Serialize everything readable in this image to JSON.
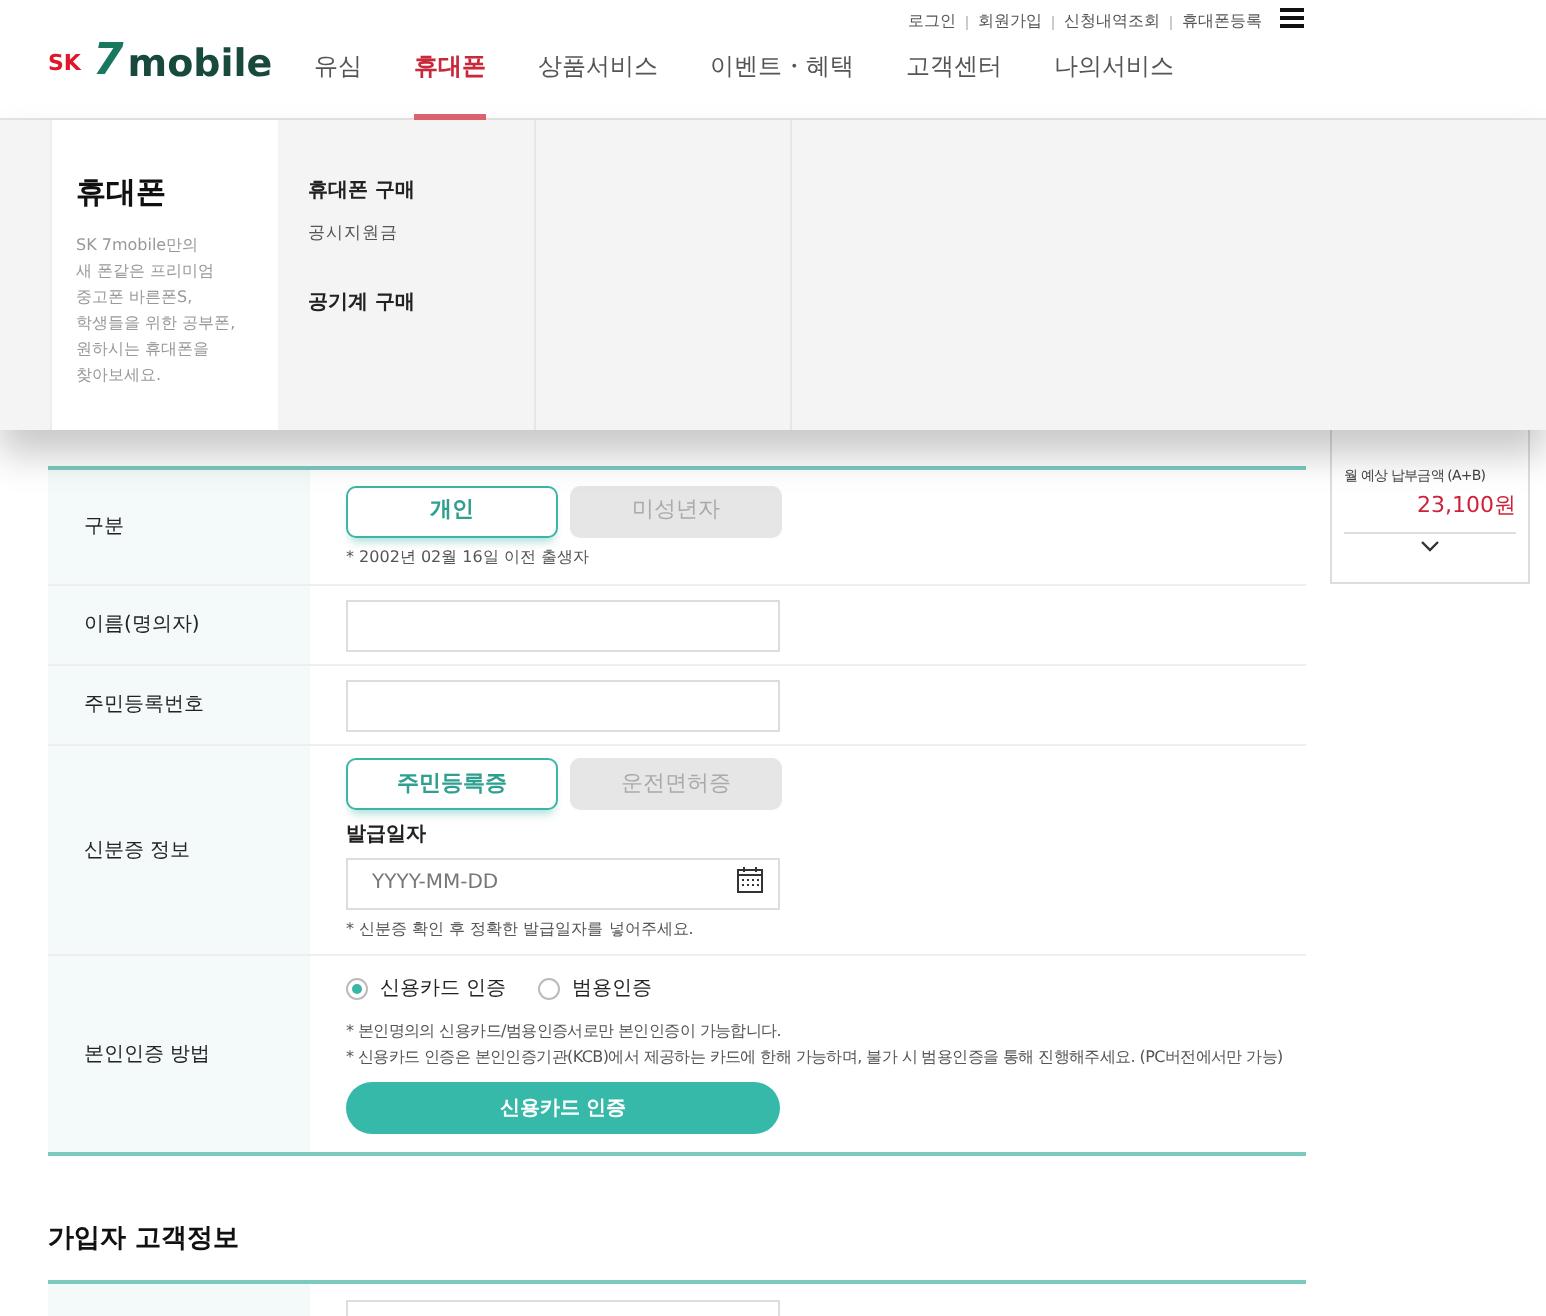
{
  "util_links": [
    "로그인",
    "회원가입",
    "신청내역조회",
    "휴대폰등록"
  ],
  "logo": {
    "prefix": "SK",
    "digit": "7",
    "word": "mobile"
  },
  "nav": [
    {
      "label": "유심",
      "selected": false
    },
    {
      "label": "휴대폰",
      "selected": true
    },
    {
      "label": "상품서비스",
      "selected": false
    },
    {
      "label": "이벤트・혜택",
      "selected": false
    },
    {
      "label": "고객센터",
      "selected": false
    },
    {
      "label": "나의서비스",
      "selected": false
    }
  ],
  "mega_menu": {
    "title": "휴대폰",
    "description": "SK 7mobile만의\n새 폰같은 프리미엄\n중고폰 바른폰S,\n학생들을 위한 공부폰,\n원하시는 휴대폰을\n찾아보세요.",
    "items": [
      {
        "label": "휴대폰 구매",
        "kind": "heading"
      },
      {
        "label": "공시지원금",
        "kind": "sub"
      },
      {
        "label": "공기계 구매",
        "kind": "heading"
      }
    ]
  },
  "form_rows": [
    {
      "label": "구분",
      "kind": "toggle",
      "options": [
        {
          "label": "개인",
          "selected": true
        },
        {
          "label": "미성년자",
          "selected": false
        }
      ],
      "note": "* 2002년 02월 16일 이전 출생자"
    },
    {
      "label": "이름(명의자)",
      "kind": "input"
    },
    {
      "label": "주민등록번호",
      "kind": "input"
    },
    {
      "label": "신분증 정보",
      "kind": "id",
      "options": [
        {
          "label": "주민등록증",
          "selected": true
        },
        {
          "label": "운전면허증",
          "selected": false
        }
      ],
      "date_label": "발급일자",
      "date_placeholder": "YYYY-MM-DD",
      "note": "* 신분증 확인 후 정확한 발급일자를 넣어주세요."
    },
    {
      "label": "본인인증 방법",
      "kind": "auth",
      "radios": [
        {
          "label": "신용카드 인증",
          "selected": true
        },
        {
          "label": "범용인증",
          "selected": false
        }
      ],
      "notes": [
        "* 본인명의의 신용카드/범용인증서로만 본인인증이 가능합니다.",
        "* 신용카드 인증은 본인인증기관(KCB)에서 제공하는 카드에 한해 가능하며, 불가 시 범용인증을 통해 진행해주세요. (PC버전에서만 가능)"
      ],
      "button": "신용카드 인증"
    }
  ],
  "section2": {
    "title": "가입자 고객정보"
  },
  "summary": {
    "label": "월 예상 납부금액 (A+B)",
    "amount": "23,100원"
  }
}
